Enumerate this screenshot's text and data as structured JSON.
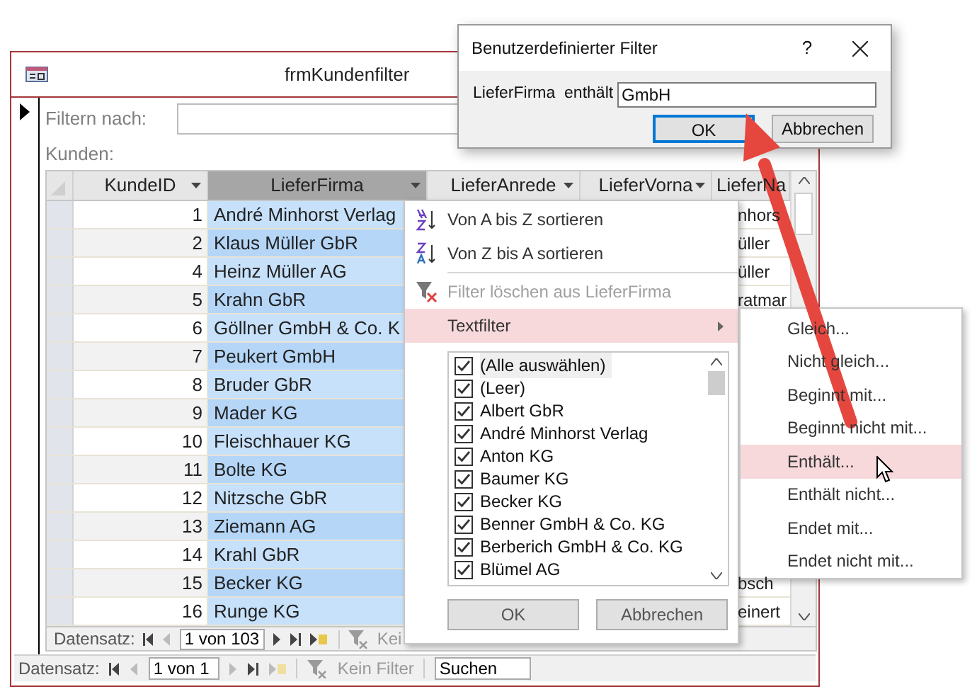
{
  "form": {
    "title": "frmKundenfilter",
    "filter_label": "Filtern nach:",
    "list_label": "Kunden:"
  },
  "datasheet": {
    "columns": [
      {
        "label": "KundeID",
        "selected": false
      },
      {
        "label": "LieferFirma",
        "selected": true
      },
      {
        "label": "LieferAnrede",
        "selected": false
      },
      {
        "label": "LieferVorna",
        "selected": false
      },
      {
        "label": "LieferNa",
        "selected": false
      }
    ],
    "rows": [
      {
        "id": "1",
        "firma": "André Minhorst Verlag",
        "column_6": "nhors"
      },
      {
        "id": "2",
        "firma": "Klaus Müller GbR",
        "column_6": "üller"
      },
      {
        "id": "4",
        "firma": "Heinz Müller AG",
        "column_6": "üller"
      },
      {
        "id": "5",
        "firma": "Krahn GbR",
        "column_6": "ratmar"
      },
      {
        "id": "6",
        "firma": "Göllner GmbH & Co. K"
      },
      {
        "id": "7",
        "firma": "Peukert GmbH"
      },
      {
        "id": "8",
        "firma": "Bruder GbR"
      },
      {
        "id": "9",
        "firma": "Mader KG"
      },
      {
        "id": "10",
        "firma": "Fleischhauer KG"
      },
      {
        "id": "11",
        "firma": "Bolte KG"
      },
      {
        "id": "12",
        "firma": "Nitzsche GbR"
      },
      {
        "id": "13",
        "firma": "Ziemann AG"
      },
      {
        "id": "14",
        "firma": "Krahl GbR"
      },
      {
        "id": "15",
        "firma": "Becker KG",
        "column_6": "bsch"
      },
      {
        "id": "16",
        "firma": "Runge KG",
        "column_6": "einert"
      }
    ],
    "nav": {
      "label": "Datensatz:",
      "position": "1 von 103",
      "filter": "Kei"
    }
  },
  "record_nav": {
    "label": "Datensatz:",
    "position": "1 von 1",
    "filter": "Kein Filter",
    "search_placeholder": "Suchen"
  },
  "column_menu": {
    "items": [
      {
        "kind": "sort_ascending",
        "label": "Von A bis Z sortieren",
        "disabled": false,
        "selected": false
      },
      {
        "kind": "sort_descending",
        "label": "Von Z bis A sortieren",
        "disabled": false,
        "selected": false
      },
      {
        "kind": "clear_filter",
        "label": "Filter löschen aus LieferFirma",
        "disabled": true,
        "selected": false
      },
      {
        "kind": "submenu",
        "label": "Textfilter",
        "disabled": false,
        "selected": true
      }
    ],
    "values": [
      {
        "label": "(Alle auswählen)",
        "checked": true,
        "selected": true
      },
      {
        "label": "(Leer)",
        "checked": true,
        "selected": false
      },
      {
        "label": "Albert GbR",
        "checked": true,
        "selected": false
      },
      {
        "label": "André Minhorst Verlag",
        "checked": true,
        "selected": false
      },
      {
        "label": "Anton KG",
        "checked": true,
        "selected": false
      },
      {
        "label": "Baumer KG",
        "checked": true,
        "selected": false
      },
      {
        "label": "Becker KG",
        "checked": true,
        "selected": false
      },
      {
        "label": "Benner GmbH & Co. KG",
        "checked": true,
        "selected": false
      },
      {
        "label": "Berberich GmbH & Co. KG",
        "checked": true,
        "selected": false
      },
      {
        "label": "Blümel AG",
        "checked": true,
        "selected": false
      }
    ],
    "buttons": [
      "OK",
      "Abbrechen"
    ]
  },
  "text_filter_menu": {
    "items": [
      {
        "label": "Gleich...",
        "selected": false
      },
      {
        "label": "Nicht gleich...",
        "selected": false
      },
      {
        "label": "Beginnt mit...",
        "selected": false
      },
      {
        "label": "Beginnt nicht mit...",
        "selected": false
      },
      {
        "label": "Enthält...",
        "selected": true
      },
      {
        "label": "Enthält nicht...",
        "selected": false
      },
      {
        "label": "Endet mit...",
        "selected": false
      },
      {
        "label": "Endet nicht mit...",
        "selected": false
      }
    ]
  },
  "dialog": {
    "title": "Benutzerdefinierter Filter",
    "help": "?",
    "field_label": "LieferFirma  enthält",
    "value": "GmbH",
    "buttons": [
      {
        "label": "OK",
        "default": true
      },
      {
        "label": "Abbrechen",
        "default": false
      }
    ]
  }
}
